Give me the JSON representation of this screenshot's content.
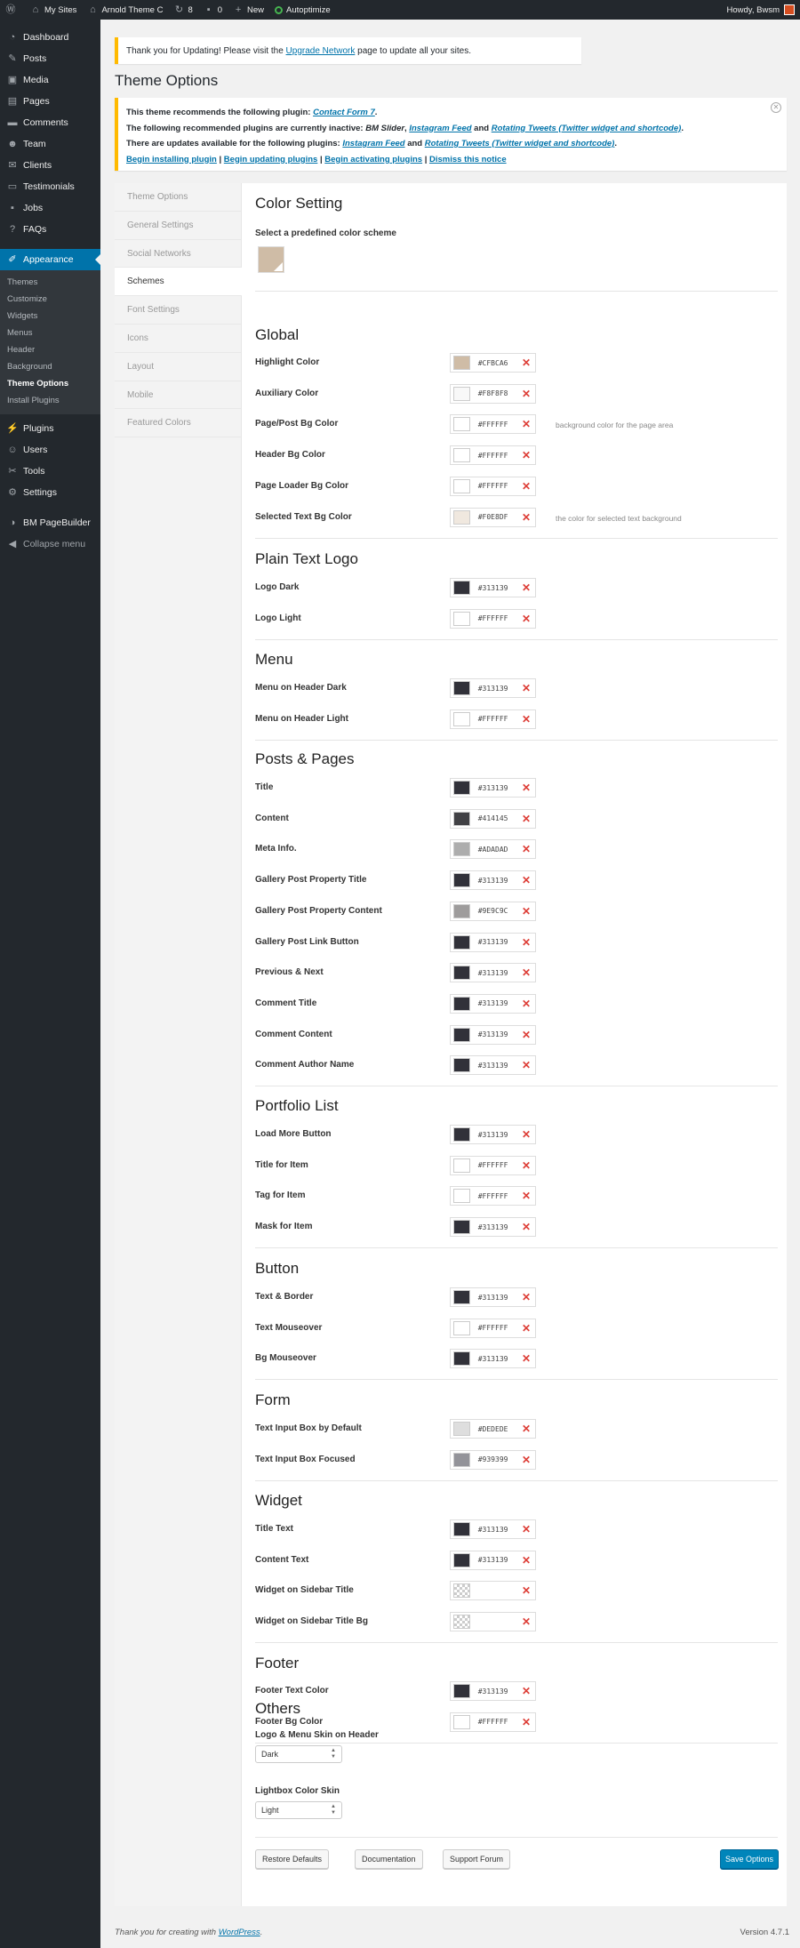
{
  "adminbar": {
    "my_sites": "My Sites",
    "site_name": "Arnold Theme C",
    "updates": "8",
    "comments": "0",
    "new": "New",
    "autoptimize": "Autoptimize",
    "howdy": "Howdy, Bwsm"
  },
  "sidebar": {
    "items_top": [
      {
        "label": "Dashboard",
        "icon": "dashboard-icon",
        "glyph": "◔"
      },
      {
        "label": "Posts",
        "icon": "pin-icon",
        "glyph": "✎"
      },
      {
        "label": "Media",
        "icon": "media-icon",
        "glyph": "▣"
      },
      {
        "label": "Pages",
        "icon": "pages-icon",
        "glyph": "▤"
      },
      {
        "label": "Comments",
        "icon": "comment-icon",
        "glyph": "▬"
      },
      {
        "label": "Team",
        "icon": "team-icon",
        "glyph": "☻"
      },
      {
        "label": "Clients",
        "icon": "clients-icon",
        "glyph": "✉"
      },
      {
        "label": "Testimonials",
        "icon": "testimonials-icon",
        "glyph": "▭"
      },
      {
        "label": "Jobs",
        "icon": "jobs-icon",
        "glyph": "▪"
      },
      {
        "label": "FAQs",
        "icon": "faq-icon",
        "glyph": "?"
      }
    ],
    "appearance": {
      "label": "Appearance",
      "icon": "appearance-icon",
      "glyph": "✐"
    },
    "submenu": [
      "Themes",
      "Customize",
      "Widgets",
      "Menus",
      "Header",
      "Background",
      "Theme Options",
      "Install Plugins"
    ],
    "items_bottom": [
      {
        "label": "Plugins",
        "icon": "plugins-icon",
        "glyph": "⚡"
      },
      {
        "label": "Users",
        "icon": "users-icon",
        "glyph": "☺"
      },
      {
        "label": "Tools",
        "icon": "tools-icon",
        "glyph": "✂"
      },
      {
        "label": "Settings",
        "icon": "settings-icon",
        "glyph": "⚙"
      }
    ],
    "pagebuilder": {
      "label": "BM PageBuilder",
      "icon": "pagebuilder-icon",
      "glyph": "◑"
    },
    "collapse": {
      "label": "Collapse menu",
      "icon": "collapse-icon",
      "glyph": "◀"
    }
  },
  "notice_update": {
    "before": "Thank you for Updating! Please visit the ",
    "link": "Upgrade Network",
    "after": " page to update all your sites."
  },
  "page_title": "Theme Options",
  "notice_plugins": {
    "line1_text": "This theme recommends the following plugin: ",
    "line1_link": "Contact Form 7",
    "line2_text": "The following recommended plugins are currently inactive: ",
    "line2_item1": "BM Slider",
    "line2_link1": "Instagram Feed",
    "line2_and": " and ",
    "line2_link2": "Rotating Tweets (Twitter widget and shortcode)",
    "line3_text": "There are updates available for the following plugins: ",
    "line3_link1": "Instagram Feed",
    "line3_and": " and ",
    "line3_link2": "Rotating Tweets (Twitter widget and shortcode)",
    "actions": [
      "Begin installing plugin",
      "Begin updating plugins",
      "Begin activating plugins",
      "Dismiss this notice"
    ]
  },
  "tabs": [
    "Theme Options",
    "General Settings",
    "Social Networks",
    "Schemes",
    "Font Settings",
    "Icons",
    "Layout",
    "Mobile",
    "Featured Colors"
  ],
  "content": {
    "color_setting_title": "Color Setting",
    "predefined_label": "Select a predefined color scheme",
    "global_title": "Global",
    "global": [
      {
        "label": "Highlight Color",
        "hex": "#CFBCA6",
        "color": "#CFBCA6"
      },
      {
        "label": "Auxiliary Color",
        "hex": "#F8F8F8",
        "color": "#F8F8F8"
      },
      {
        "label": "Page/Post Bg Color",
        "hex": "#FFFFFF",
        "color": "#FFFFFF",
        "desc": "background color for the page area"
      },
      {
        "label": "Header Bg Color",
        "hex": "#FFFFFF",
        "color": "#FFFFFF"
      },
      {
        "label": "Page Loader Bg Color",
        "hex": "#FFFFFF",
        "color": "#FFFFFF"
      },
      {
        "label": "Selected Text Bg Color",
        "hex": "#F0E8DF",
        "color": "#F0E8DF",
        "desc": "the color for selected text background"
      }
    ],
    "logo_title": "Plain Text Logo",
    "logo": [
      {
        "label": "Logo Dark",
        "hex": "#313139",
        "color": "#313139"
      },
      {
        "label": "Logo Light",
        "hex": "#FFFFFF",
        "color": "#FFFFFF"
      }
    ],
    "menu_title": "Menu",
    "menu": [
      {
        "label": "Menu on Header Dark",
        "hex": "#313139",
        "color": "#313139"
      },
      {
        "label": "Menu on Header Light",
        "hex": "#FFFFFF",
        "color": "#FFFFFF"
      }
    ],
    "posts_title": "Posts & Pages",
    "posts": [
      {
        "label": "Title",
        "hex": "#313139",
        "color": "#313139"
      },
      {
        "label": "Content",
        "hex": "#414145",
        "color": "#414145"
      },
      {
        "label": "Meta Info.",
        "hex": "#ADADAD",
        "color": "#ADADAD"
      },
      {
        "label": "Gallery Post Property Title",
        "hex": "#313139",
        "color": "#313139"
      },
      {
        "label": "Gallery Post Property Content",
        "hex": "#9E9C9C",
        "color": "#9E9C9C"
      },
      {
        "label": "Gallery Post Link Button",
        "hex": "#313139",
        "color": "#313139"
      },
      {
        "label": "Previous & Next",
        "hex": "#313139",
        "color": "#313139"
      },
      {
        "label": "Comment Title",
        "hex": "#313139",
        "color": "#313139"
      },
      {
        "label": "Comment Content",
        "hex": "#313139",
        "color": "#313139"
      },
      {
        "label": "Comment Author Name",
        "hex": "#313139",
        "color": "#313139"
      }
    ],
    "portfolio_title": "Portfolio List",
    "portfolio": [
      {
        "label": "Load More Button",
        "hex": "#313139",
        "color": "#313139"
      },
      {
        "label": "Title for Item",
        "hex": "#FFFFFF",
        "color": "#FFFFFF"
      },
      {
        "label": "Tag for Item",
        "hex": "#FFFFFF",
        "color": "#FFFFFF"
      },
      {
        "label": "Mask for Item",
        "hex": "#313139",
        "color": "#313139"
      }
    ],
    "button_title": "Button",
    "button": [
      {
        "label": "Text & Border",
        "hex": "#313139",
        "color": "#313139"
      },
      {
        "label": "Text Mouseover",
        "hex": "#FFFFFF",
        "color": "#FFFFFF"
      },
      {
        "label": "Bg Mouseover",
        "hex": "#313139",
        "color": "#313139"
      }
    ],
    "form_title": "Form",
    "form": [
      {
        "label": "Text Input Box by Default",
        "hex": "#DEDEDE",
        "color": "#DEDEDE"
      },
      {
        "label": "Text Input Box Focused",
        "hex": "#939399",
        "color": "#939399"
      }
    ],
    "widget_title": "Widget",
    "widget": [
      {
        "label": "Title Text",
        "hex": "#313139",
        "color": "#313139"
      },
      {
        "label": "Content Text",
        "hex": "#313139",
        "color": "#313139"
      },
      {
        "label": "Widget on Sidebar Title",
        "hex": "",
        "color": "transparent"
      },
      {
        "label": "Widget on Sidebar Title Bg",
        "hex": "",
        "color": "transparent"
      }
    ],
    "footer_title": "Footer",
    "footer": [
      {
        "label": "Footer Text Color",
        "hex": "#313139",
        "color": "#313139"
      },
      {
        "label": "Footer Bg Color",
        "hex": "#FFFFFF",
        "color": "#FFFFFF"
      }
    ],
    "others_title": "Others",
    "skin_header_label": "Logo & Menu Skin on Header",
    "skin_header_value": "Dark",
    "lightbox_label": "Lightbox Color Skin",
    "lightbox_value": "Light"
  },
  "buttons": {
    "restore": "Restore Defaults",
    "docs": "Documentation",
    "support": "Support Forum",
    "save": "Save Options"
  },
  "wp_footer": {
    "text": "Thank you for creating with ",
    "link": "WordPress",
    "dot": ".",
    "version": "Version 4.7.1"
  },
  "colors": {
    "accent": "#0073aa",
    "sidebar": "#23282d",
    "notice": "#ffba00",
    "clear_x": "#dd3d36"
  }
}
